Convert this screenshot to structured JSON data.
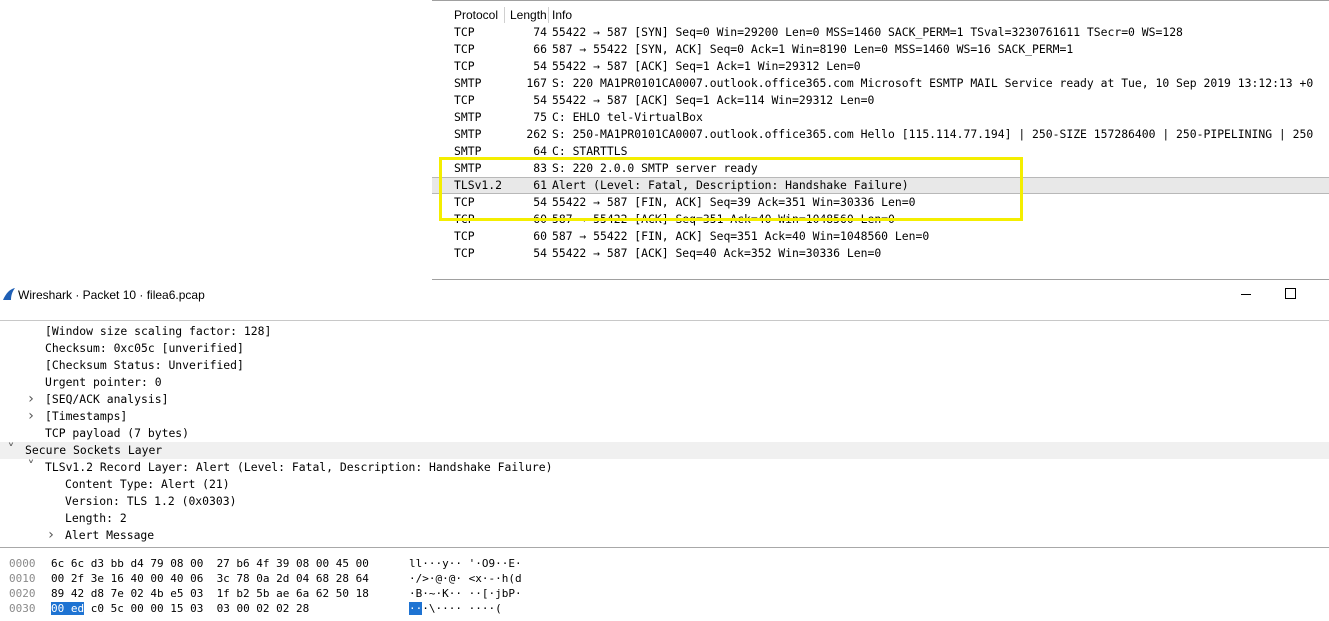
{
  "packet_list": {
    "columns": [
      "Protocol",
      "Length",
      "Info"
    ],
    "rows": [
      {
        "protocol": "TCP",
        "length": "74",
        "info": "55422 → 587 [SYN] Seq=0 Win=29200 Len=0 MSS=1460 SACK_PERM=1 TSval=3230761611 TSecr=0 WS=128"
      },
      {
        "protocol": "TCP",
        "length": "66",
        "info": "587 → 55422 [SYN, ACK] Seq=0 Ack=1 Win=8190 Len=0 MSS=1460 WS=16 SACK_PERM=1"
      },
      {
        "protocol": "TCP",
        "length": "54",
        "info": "55422 → 587 [ACK] Seq=1 Ack=1 Win=29312 Len=0"
      },
      {
        "protocol": "SMTP",
        "length": "167",
        "info": "S: 220 MA1PR0101CA0007.outlook.office365.com Microsoft ESMTP MAIL Service ready at Tue, 10 Sep 2019 13:12:13 +0"
      },
      {
        "protocol": "TCP",
        "length": "54",
        "info": "55422 → 587 [ACK] Seq=1 Ack=114 Win=29312 Len=0"
      },
      {
        "protocol": "SMTP",
        "length": "75",
        "info": "C: EHLO tel-VirtualBox"
      },
      {
        "protocol": "SMTP",
        "length": "262",
        "info": "S: 250-MA1PR0101CA0007.outlook.office365.com Hello [115.114.77.194] | 250-SIZE 157286400 | 250-PIPELINING | 250"
      },
      {
        "protocol": "SMTP",
        "length": "64",
        "info": "C: STARTTLS"
      },
      {
        "protocol": "SMTP",
        "length": "83",
        "info": "S: 220 2.0.0 SMTP server ready"
      },
      {
        "protocol": "TLSv1.2",
        "length": "61",
        "info": "Alert (Level: Fatal, Description: Handshake Failure)"
      },
      {
        "protocol": "TCP",
        "length": "54",
        "info": "55422 → 587 [FIN, ACK] Seq=39 Ack=351 Win=30336 Len=0"
      },
      {
        "protocol": "TCP",
        "length": "60",
        "info": "587 → 55422 [ACK] Seq=351 Ack=40 Win=1048560 Len=0"
      },
      {
        "protocol": "TCP",
        "length": "60",
        "info": "587 → 55422 [FIN, ACK] Seq=351 Ack=40 Win=1048560 Len=0"
      },
      {
        "protocol": "TCP",
        "length": "54",
        "info": "55422 → 587 [ACK] Seq=40 Ack=352 Win=30336 Len=0"
      }
    ],
    "selected_row": 9,
    "highlight_color": "#f4ee00"
  },
  "window": {
    "title": "Wireshark · Packet 10 · filea6.pcap"
  },
  "detail_tree": [
    {
      "text": "[Window size scaling factor: 128]",
      "arrow": ""
    },
    {
      "text": "Checksum: 0xc05c [unverified]",
      "arrow": ""
    },
    {
      "text": "[Checksum Status: Unverified]",
      "arrow": ""
    },
    {
      "text": "Urgent pointer: 0",
      "arrow": ""
    },
    {
      "text": "[SEQ/ACK analysis]",
      "arrow": ">"
    },
    {
      "text": "[Timestamps]",
      "arrow": ">"
    },
    {
      "text": "TCP payload (7 bytes)",
      "arrow": ""
    },
    {
      "text": "Secure Sockets Layer",
      "arrow": "v"
    },
    {
      "text": "TLSv1.2 Record Layer: Alert (Level: Fatal, Description: Handshake Failure)",
      "arrow": "v"
    },
    {
      "text": "Content Type: Alert (21)",
      "arrow": ""
    },
    {
      "text": "Version: TLS 1.2 (0x0303)",
      "arrow": ""
    },
    {
      "text": "Length: 2",
      "arrow": ""
    },
    {
      "text": "Alert Message",
      "arrow": ">"
    }
  ],
  "hex_dump": [
    {
      "offset": "0000",
      "hex_pre": "",
      "hex_sel": "",
      "hex_post": "6c 6c d3 bb d4 79 08 00  27 b6 4f 39 08 00 45 00",
      "asc_pre": "",
      "asc_sel": "",
      "asc_post": "ll···y·· '·O9··E·"
    },
    {
      "offset": "0010",
      "hex_pre": "",
      "hex_sel": "",
      "hex_post": "00 2f 3e 16 40 00 40 06  3c 78 0a 2d 04 68 28 64",
      "asc_pre": "",
      "asc_sel": "",
      "asc_post": "·/>·@·@· <x·-·h(d"
    },
    {
      "offset": "0020",
      "hex_pre": "",
      "hex_sel": "",
      "hex_post": "89 42 d8 7e 02 4b e5 03  1f b2 5b ae 6a 62 50 18",
      "asc_pre": "",
      "asc_sel": "",
      "asc_post": "·B·~·K·· ··[·jbP·"
    },
    {
      "offset": "0030",
      "hex_pre": "",
      "hex_sel": "00 ed",
      "hex_post": " c0 5c 00 00 15 03  03 00 02 02 28",
      "asc_pre": "",
      "asc_sel": "··",
      "asc_post": "·\\···· ····("
    }
  ]
}
